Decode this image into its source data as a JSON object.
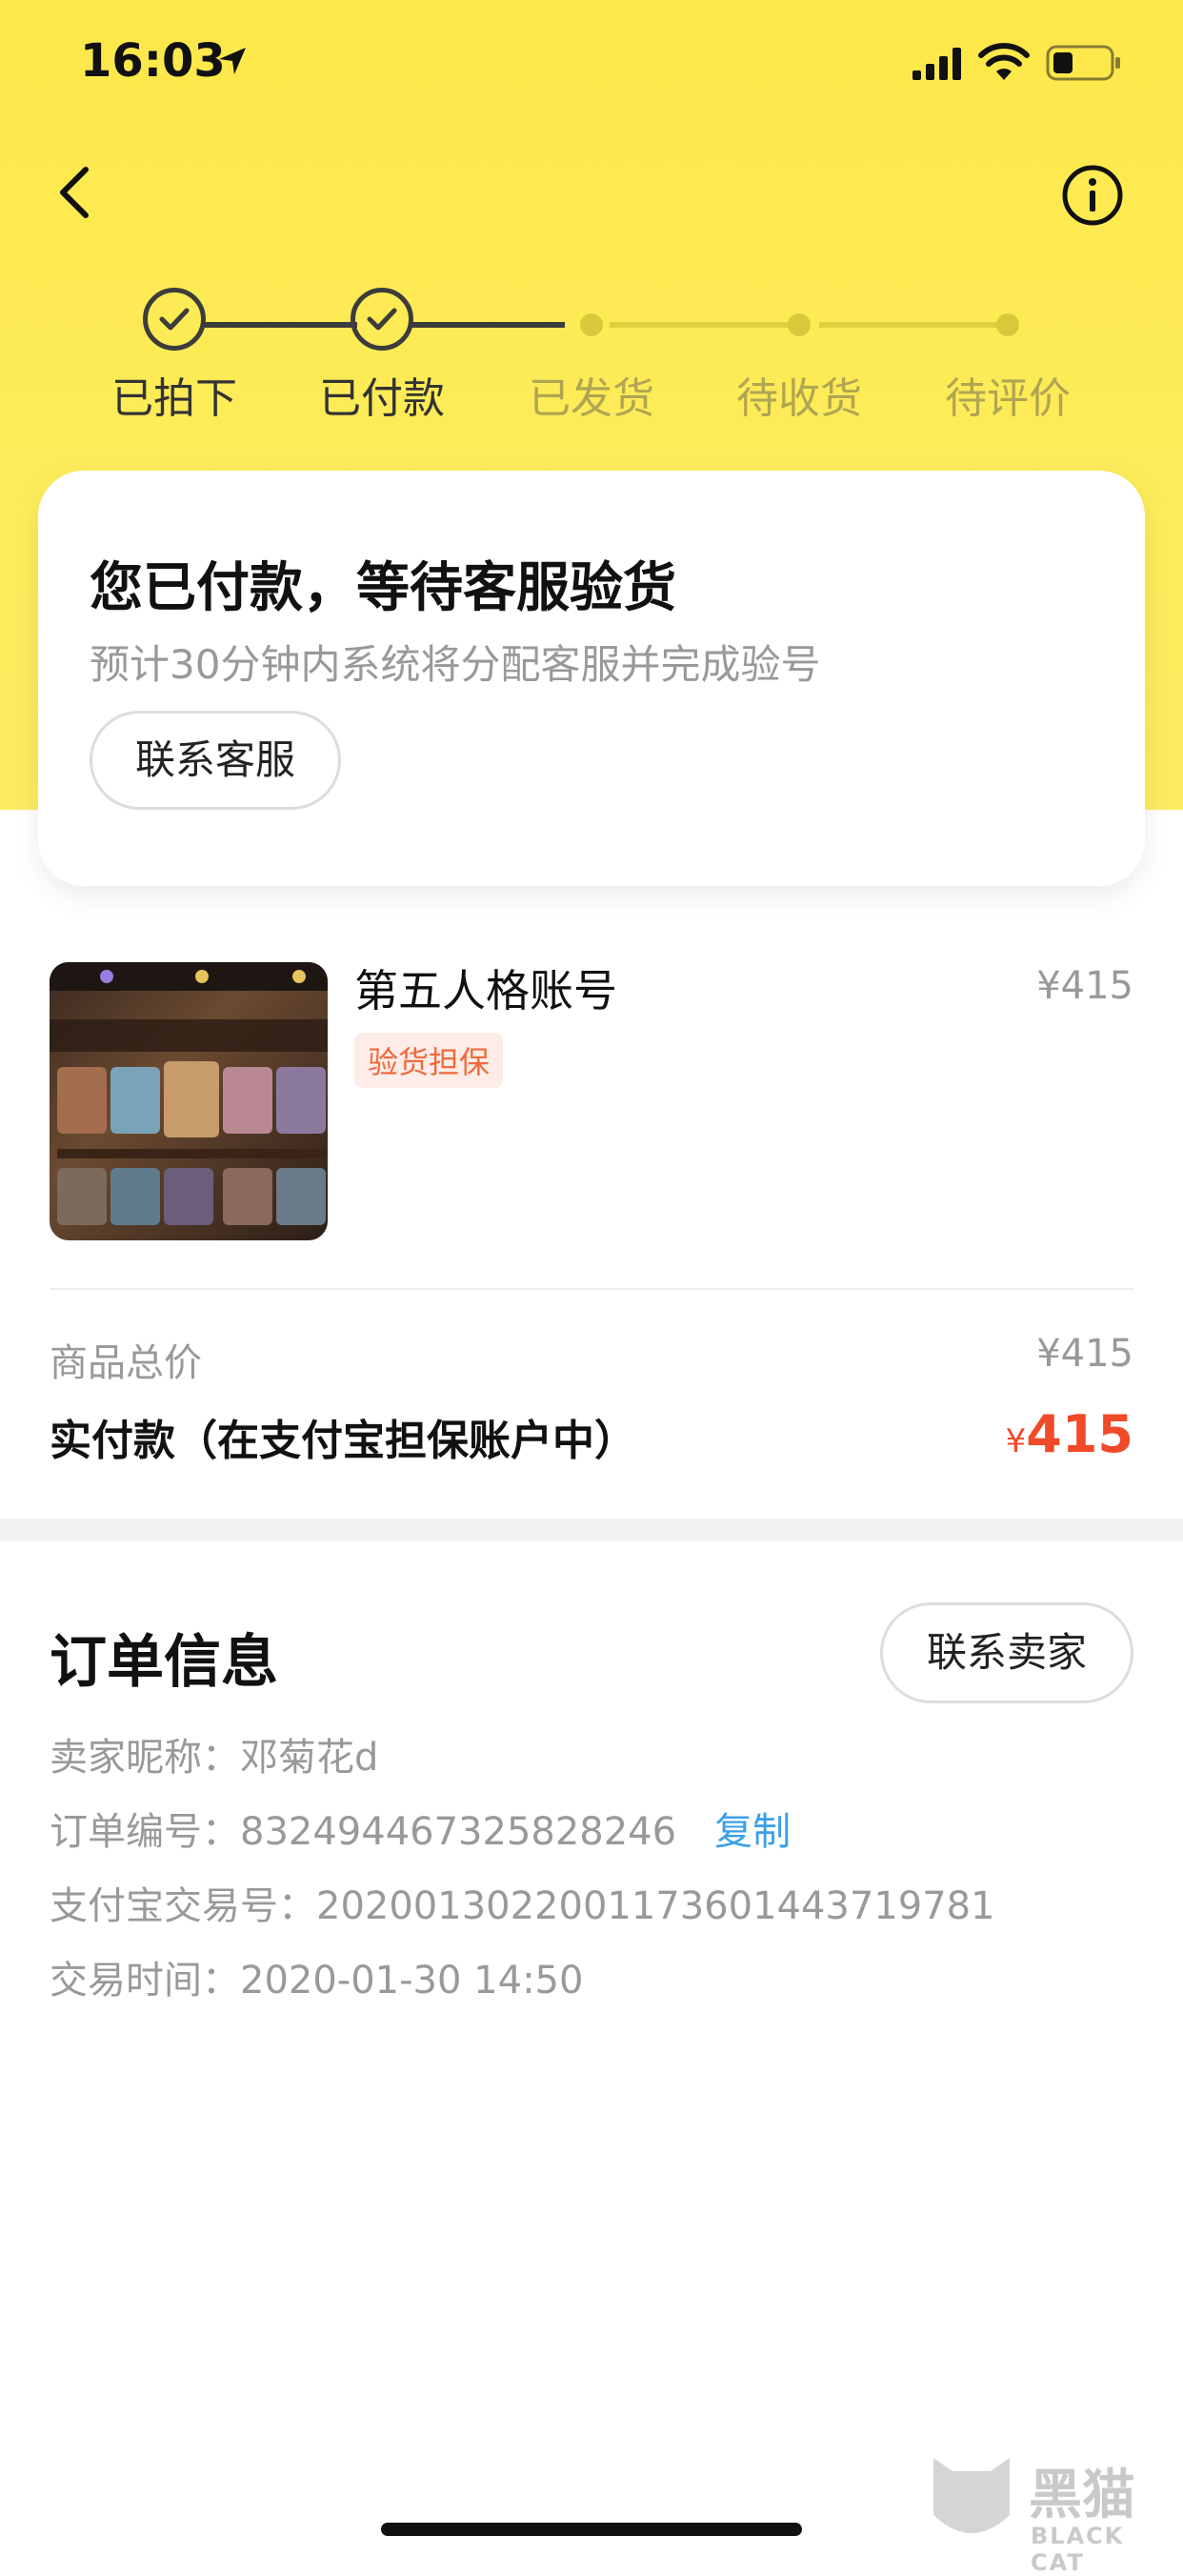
{
  "status_bar": {
    "time": "16:03"
  },
  "steps": [
    {
      "label": "已拍下",
      "done": true
    },
    {
      "label": "已付款",
      "done": true
    },
    {
      "label": "已发货",
      "done": false
    },
    {
      "label": "待收货",
      "done": false
    },
    {
      "label": "待评价",
      "done": false
    }
  ],
  "status_card": {
    "title": "您已付款，等待客服验货",
    "subtitle": "预计30分钟内系统将分配客服并完成验号",
    "contact_button": "联系客服"
  },
  "product": {
    "title": "第五人格账号",
    "price": "¥415",
    "badge": "验货担保"
  },
  "summary": {
    "total_label": "商品总价",
    "total_value": "¥415",
    "paid_label": "实付款（在支付宝担保账户中）",
    "paid_currency": "¥",
    "paid_value": "415"
  },
  "order_info": {
    "title": "订单信息",
    "contact_seller": "联系卖家",
    "seller": "卖家昵称：邓菊花d",
    "order_no": "订单编号：832494467325828246",
    "copy": "复制",
    "alipay_no": "支付宝交易号：2020013022001173601443719781",
    "time": "交易时间：2020-01-30 14:50"
  },
  "watermark": {
    "cn": "黑猫",
    "en": "BLACK CAT"
  },
  "colors": {
    "header_yellow": "#fde84a",
    "accent_red": "#f04a2a",
    "link_blue": "#3aa0e8",
    "badge_orange": "#f06a3c"
  }
}
